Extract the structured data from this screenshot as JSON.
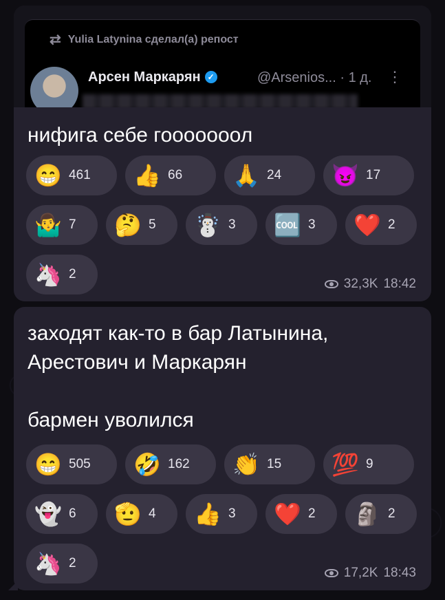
{
  "repost": {
    "repost_line": "Yulia Latynina сделал(а) репост",
    "author_name": "Арсен Маркарян",
    "handle": "@Arsenios...",
    "time": "· 1 д.",
    "more": "⋮"
  },
  "messages": [
    {
      "text": "нифига себе гооооооол",
      "views": "32,3K",
      "time": "18:42",
      "reactions_row1": [
        {
          "emoji": "😁",
          "count": "461"
        },
        {
          "emoji": "👍",
          "count": "66"
        },
        {
          "emoji": "🙏",
          "count": "24"
        },
        {
          "emoji": "😈",
          "count": "17"
        }
      ],
      "reactions_row2": [
        {
          "emoji": "🤷‍♂️",
          "count": "7"
        },
        {
          "emoji": "🤔",
          "count": "5"
        },
        {
          "emoji": "☃️",
          "count": "3"
        },
        {
          "emoji": "🆒",
          "count": "3"
        },
        {
          "emoji": "❤️",
          "count": "2"
        }
      ],
      "reactions_row3": [
        {
          "emoji": "🦄",
          "count": "2"
        }
      ]
    },
    {
      "text": "заходят как-то в бар Латынина,\nАрестович и Маркарян\n\nбармен уволился",
      "views": "17,2K",
      "time": "18:43",
      "reactions_row1": [
        {
          "emoji": "😁",
          "count": "505"
        },
        {
          "emoji": "🤣",
          "count": "162"
        },
        {
          "emoji": "👏",
          "count": "15"
        },
        {
          "emoji": "💯",
          "count": "9"
        }
      ],
      "reactions_row2": [
        {
          "emoji": "👻",
          "count": "6"
        },
        {
          "emoji": "🫡",
          "count": "4"
        },
        {
          "emoji": "👍",
          "count": "3"
        },
        {
          "emoji": "❤️",
          "count": "2"
        },
        {
          "emoji": "🗿",
          "count": "2"
        }
      ],
      "reactions_row3": [
        {
          "emoji": "🦄",
          "count": "2"
        }
      ]
    }
  ]
}
